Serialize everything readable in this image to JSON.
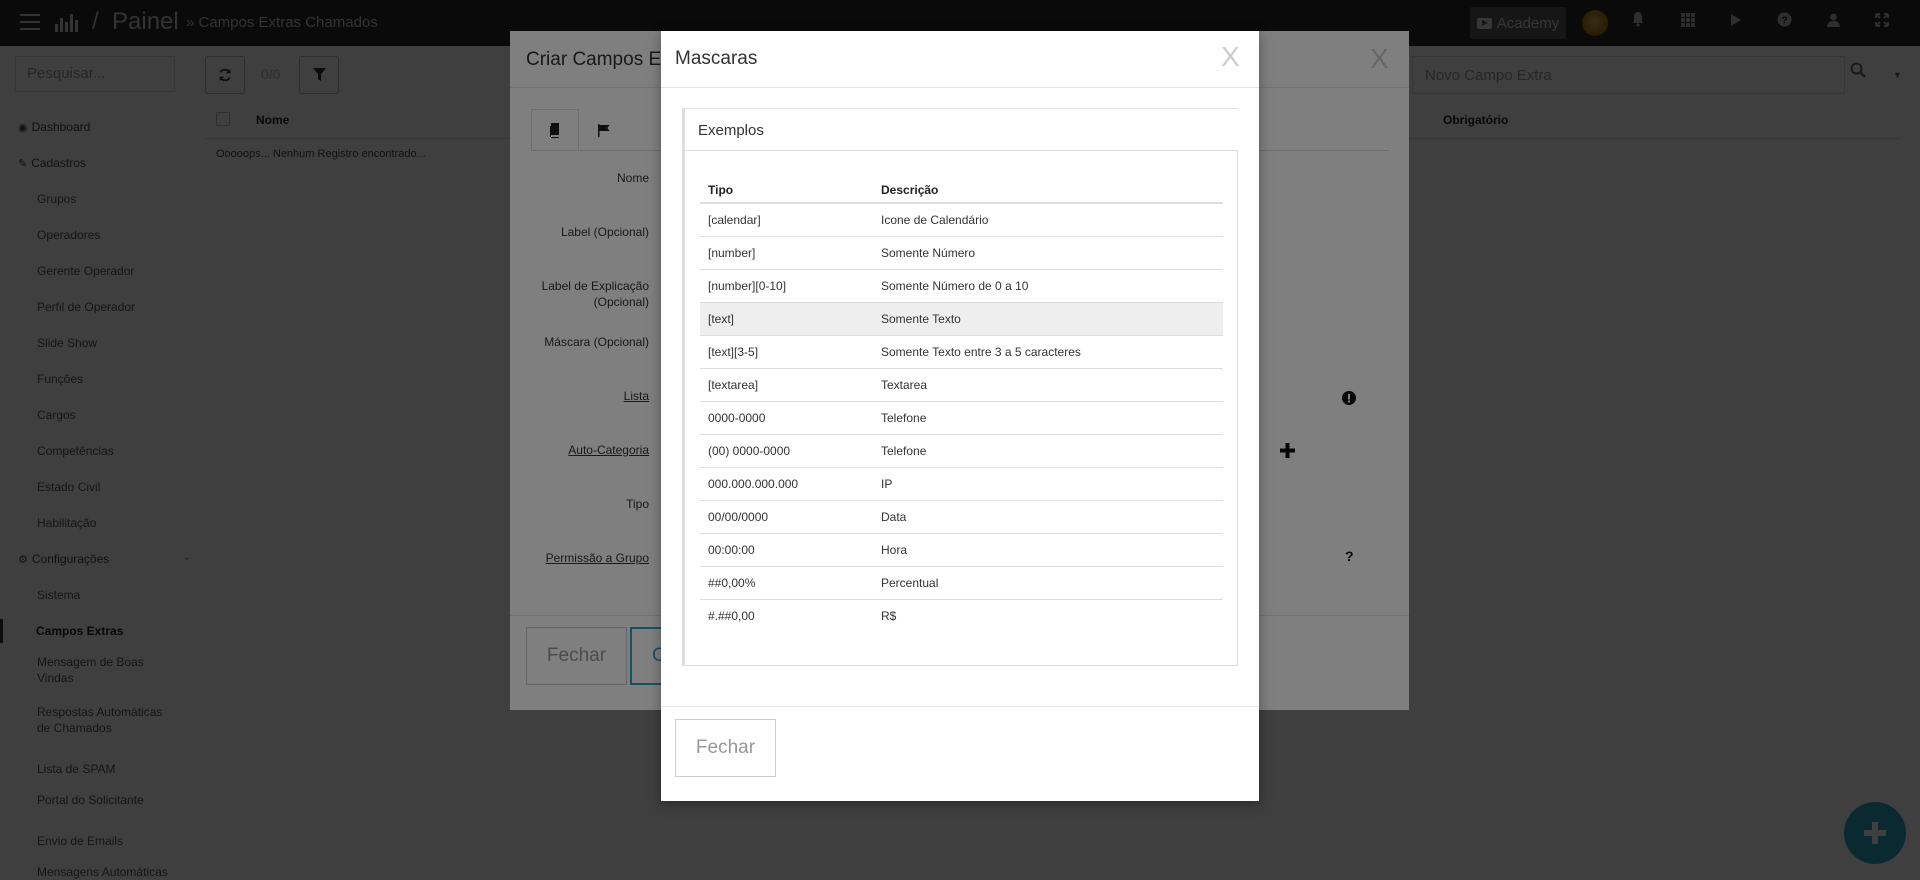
{
  "topbar": {
    "app_name": "Painel",
    "slash": "/",
    "breadcrumb": "» Campos Extras Chamados",
    "academy_label": "Academy",
    "icons": [
      "menu-icon",
      "logo-icon",
      "youtube-icon",
      "avatar",
      "bell-icon",
      "apps-grid-icon",
      "play-icon",
      "help-icon",
      "user-icon",
      "fullscreen-icon"
    ]
  },
  "sidebar": {
    "search_placeholder": "Pesquisar...",
    "items": [
      {
        "label": "Dashboard",
        "kind": "section",
        "icon": "dashboard-icon"
      },
      {
        "label": "Cadastros",
        "kind": "section",
        "icon": "edit-icon"
      },
      {
        "label": "Grupos",
        "kind": "sub"
      },
      {
        "label": "Operadores",
        "kind": "sub"
      },
      {
        "label": "Gerente Operador",
        "kind": "sub"
      },
      {
        "label": "Perfil de Operador",
        "kind": "sub"
      },
      {
        "label": "Slide Show",
        "kind": "sub"
      },
      {
        "label": "Funções",
        "kind": "sub"
      },
      {
        "label": "Cargos",
        "kind": "sub"
      },
      {
        "label": "Competências",
        "kind": "sub"
      },
      {
        "label": "Estado Civil",
        "kind": "sub"
      },
      {
        "label": "Habilitação",
        "kind": "sub"
      },
      {
        "label": "Configurações",
        "kind": "section",
        "icon": "gear-icon"
      },
      {
        "label": "Sistema",
        "kind": "sub"
      },
      {
        "label": "Campos Extras",
        "kind": "active"
      },
      {
        "label": "Mensagem de Boas Vindas",
        "kind": "sub"
      },
      {
        "label": "Respostas Automáticas de Chamados",
        "kind": "sub"
      },
      {
        "label": "Lista de SPAM",
        "kind": "sub"
      },
      {
        "label": "Portal do Solicitante",
        "kind": "sub"
      },
      {
        "label": "Envio de Emails",
        "kind": "sub"
      },
      {
        "label": "Mensagens Automáticas",
        "kind": "sub"
      }
    ]
  },
  "main": {
    "pager": "0/0",
    "new_field_placeholder": "Novo Campo Extra",
    "columns": {
      "nome": "Nome",
      "obrigatorio": "Obrigatório"
    },
    "empty_message": "Ooooops... Nenhum Registro encontrado..."
  },
  "modal_criar": {
    "title": "Criar Campos Extras",
    "close": "X",
    "labels": {
      "nome": "Nome",
      "label": "Label (Opcional)",
      "explicacao": "Label de Explicação (Opcional)",
      "mascara": "Máscara (Opcional)",
      "lista": "Lista",
      "auto_categoria": "Auto-Categoria",
      "tipo": "Tipo",
      "permissao": "Permissão a Grupo"
    },
    "fechar": "Fechar",
    "ok": "C"
  },
  "modal_mascaras": {
    "title": "Mascaras",
    "close": "X",
    "panel_title": "Exemplos",
    "headers": {
      "tipo": "Tipo",
      "descricao": "Descrição"
    },
    "rows": [
      {
        "tipo": "[calendar]",
        "descricao": "Icone de Calendário"
      },
      {
        "tipo": "[number]",
        "descricao": "Somente Número"
      },
      {
        "tipo": "[number][0-10]",
        "descricao": "Somente Número de 0 a 10"
      },
      {
        "tipo": "[text]",
        "descricao": "Somente Texto"
      },
      {
        "tipo": "[text][3-5]",
        "descricao": "Somente Texto entre 3 a 5 caracteres"
      },
      {
        "tipo": "[textarea]",
        "descricao": "Textarea"
      },
      {
        "tipo": "0000-0000",
        "descricao": "Telefone"
      },
      {
        "tipo": "(00) 0000-0000",
        "descricao": "Telefone"
      },
      {
        "tipo": "000.000.000.000",
        "descricao": "IP"
      },
      {
        "tipo": "00/00/0000",
        "descricao": "Data"
      },
      {
        "tipo": "00:00:00",
        "descricao": "Hora"
      },
      {
        "tipo": "##0,00%",
        "descricao": "Percentual"
      },
      {
        "tipo": "#.##0,00",
        "descricao": "R$"
      }
    ],
    "highlighted_row": 3,
    "fechar": "Fechar"
  },
  "colors": {
    "accent": "#2fa4c4",
    "topbar": "#2b2b2b"
  }
}
